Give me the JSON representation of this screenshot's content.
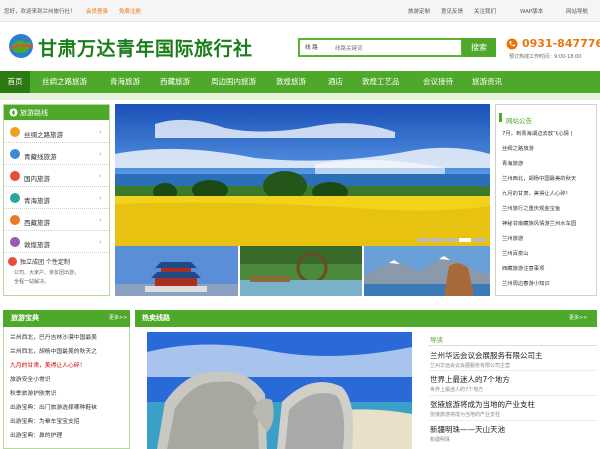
{
  "topbar": {
    "welcome": "您好，欢迎来到兰州旅行社！",
    "login": "会员登录",
    "register": "免费注册",
    "links": [
      "旅游定制",
      "意见反馈",
      "关注我们",
      "WAP版本",
      "网站导航"
    ]
  },
  "header": {
    "logo_text": "甘肃万达青年国际旅行社",
    "search_type": "线 路",
    "search_placeholder": "线路关键词",
    "search_button": "搜索",
    "phone": "0931-8477767",
    "hours": "预订热线工作时间：9:00-18:00"
  },
  "nav": {
    "items": [
      "首页",
      "丝绸之路旅游",
      "青海旅游",
      "西藏旅游",
      "周边国内旅游",
      "敦煌旅游",
      "酒店",
      "敦煌工艺品",
      "会议接待",
      "旅游资讯"
    ]
  },
  "routes": {
    "title": "旅游路线",
    "items": [
      {
        "label": "丝绸之路旅游",
        "color": "#f0a020"
      },
      {
        "label": "青藏线旅游",
        "color": "#3a8ad8"
      },
      {
        "label": "国内旅游",
        "color": "#e84c3d"
      },
      {
        "label": "青海旅游",
        "color": "#2aa6a0"
      },
      {
        "label": "西藏旅游",
        "color": "#e87a2a"
      },
      {
        "label": "敦煌旅游",
        "color": "#9b59b6"
      }
    ],
    "custom_title": "独立成团 个性定制",
    "custom_desc1": "公司、大家户、亲友团出游，",
    "custom_desc2": "全程一站解决。"
  },
  "notices": {
    "title": "网站公告",
    "items": [
      "7月，到青海湖边去放飞心情 (",
      "丝绸之路旅游",
      "青海旅游",
      "兰州西北，胡杨中国最美的秋天",
      "九月的甘肃，美得让人心碎！",
      "兰州旅行之重庆观金宝鱼",
      "神秘甘南藏族风情游兰州水车园",
      "兰州旅游",
      "兰州百泉山",
      "西藏旅游注意事项",
      "兰州周边春游小知识"
    ]
  },
  "treasure": {
    "title": "旅游宝典",
    "more": "更多>>",
    "items": [
      {
        "tag": "",
        "text": "兰州西北，巴丹吉林沙漠中国最美",
        "red": false
      },
      {
        "tag": "",
        "text": "兰州西北，胡杨中国最美的秋天之",
        "red": false
      },
      {
        "tag": "",
        "text": "九月的甘肃，美得让人心碎！",
        "red": true
      },
      {
        "tag": "",
        "text": "旅游安全小常识",
        "red": false
      },
      {
        "tag": "",
        "text": "秋季旅游护肤常识",
        "red": false
      },
      {
        "tag": "",
        "text": "出游宝典：出门旅游选择哪种鞋袜",
        "red": false
      },
      {
        "tag": "",
        "text": "出游宝典：为晕车宝宝支招",
        "red": false
      },
      {
        "tag": "",
        "text": "出游宝典：鼻的护理",
        "red": false
      }
    ]
  },
  "hot": {
    "title": "热卖线路",
    "more": "更多>>",
    "guide_label": "导读",
    "guides": [
      {
        "title": "兰州华远会议会展服务有限公司主",
        "sub": "兰州华远会议会展服务有限公司主营"
      },
      {
        "title": "世界上最迷人的7个地方",
        "sub": "世界上最迷人的7个地方"
      },
      {
        "title": "张掖旅游将成为当地的产业支柱",
        "sub": "张掖旅游将成为当地的产业支柱"
      },
      {
        "title": "新疆明珠——天山天池",
        "sub": "新疆明珠"
      }
    ]
  }
}
